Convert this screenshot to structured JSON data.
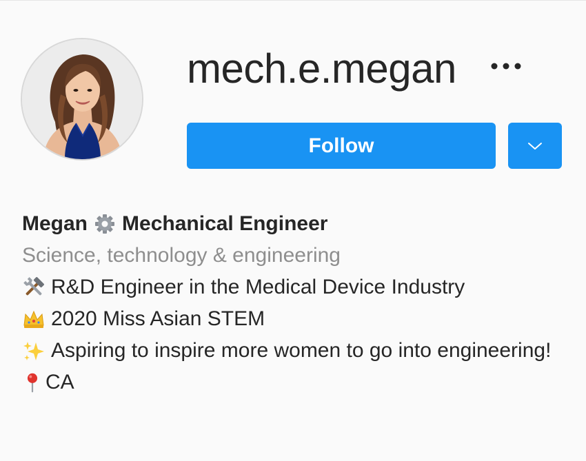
{
  "profile": {
    "username": "mech.e.megan",
    "follow_label": "Follow",
    "name_first": "Megan",
    "name_title": "Mechanical Engineer",
    "category": "Science, technology & engineering",
    "bio": [
      {
        "icon": "hammer-wrench-icon",
        "text": "R&D Engineer in the Medical Device Industry"
      },
      {
        "icon": "crown-icon",
        "text": "2020 Miss Asian STEM"
      },
      {
        "icon": "sparkles-icon",
        "text": "Aspiring to inspire more women to go into engineering!"
      },
      {
        "icon": "pin-icon",
        "text": "CA"
      }
    ]
  },
  "icons": {
    "more": "more-dots-icon",
    "dropdown": "chevron-down-icon",
    "name_separator": "gear-icon"
  },
  "colors": {
    "accent": "#1993f3",
    "text": "#262626",
    "secondary_text": "#8e8e8e",
    "background": "#fafafa"
  }
}
